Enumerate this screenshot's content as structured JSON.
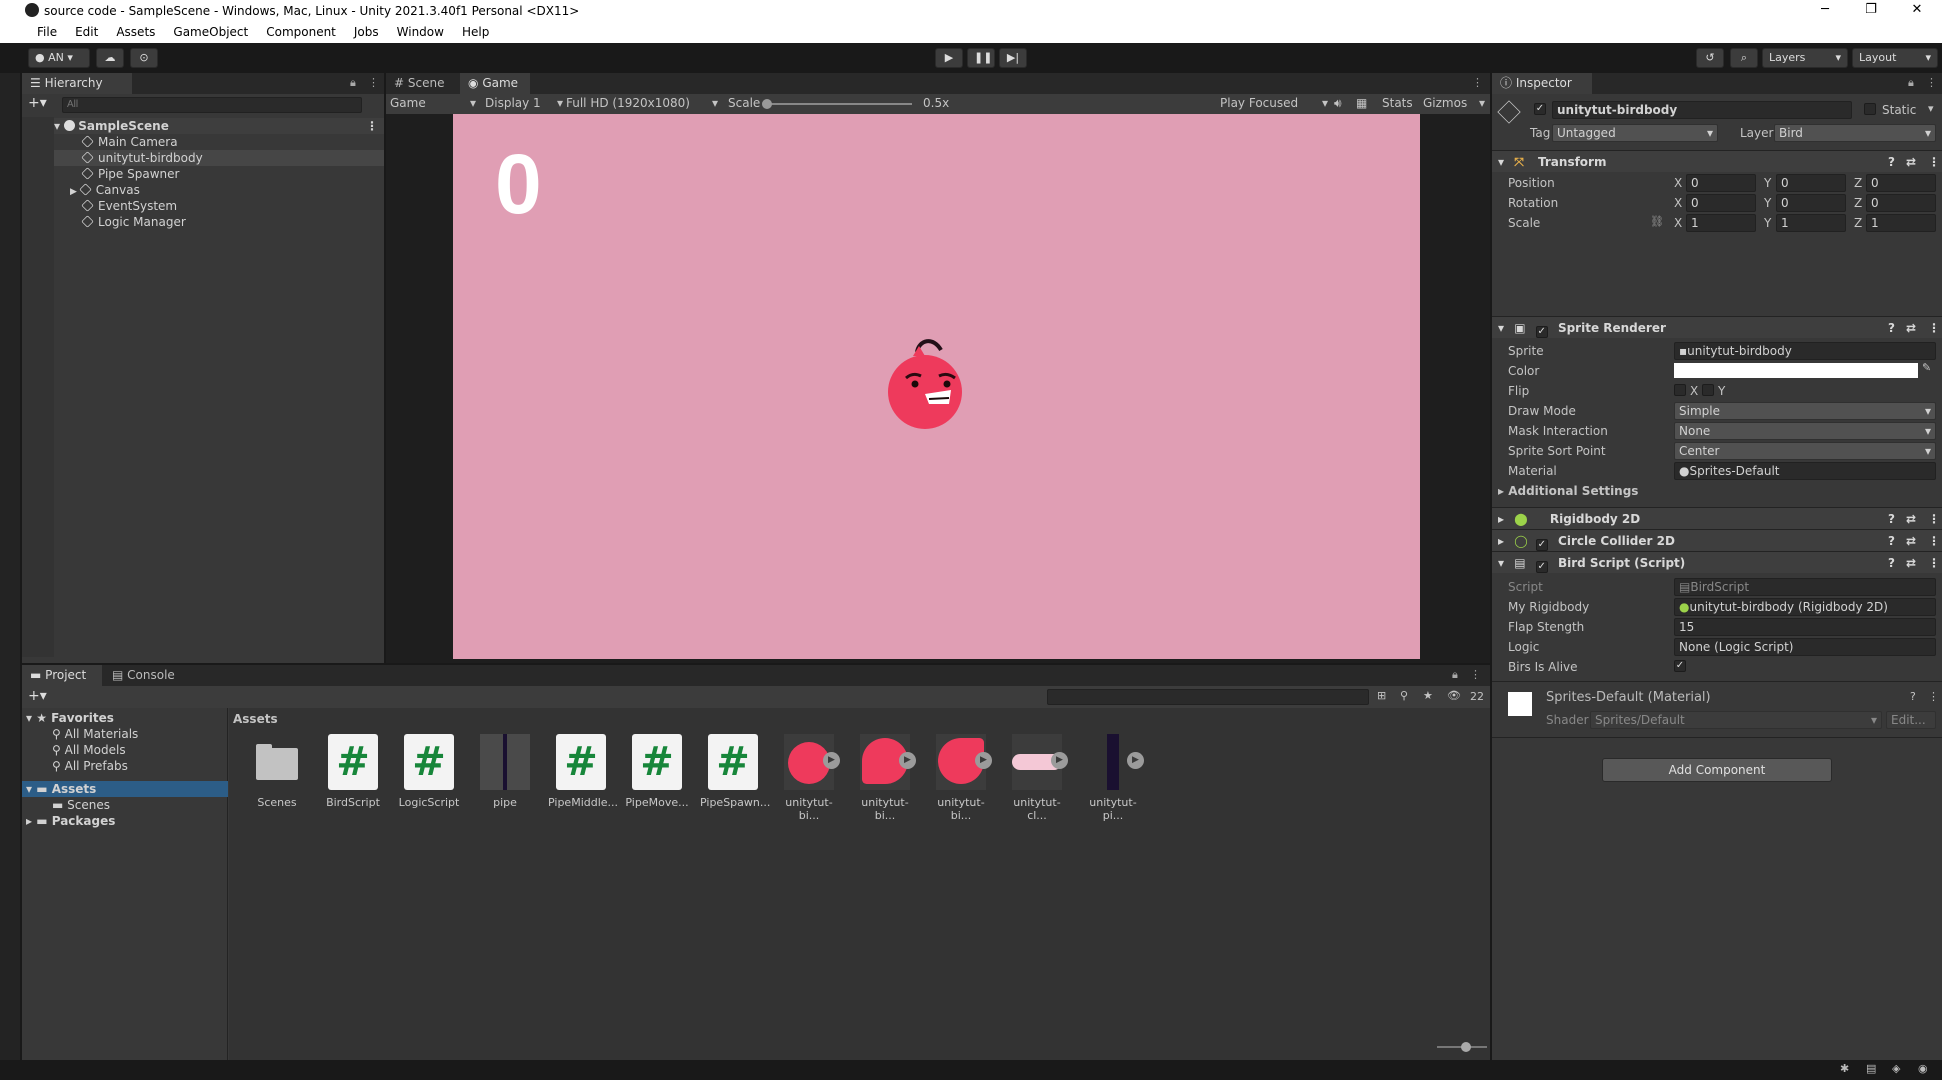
{
  "window": {
    "title": "source code - SampleScene - Windows, Mac, Linux - Unity 2021.3.40f1 Personal <DX11>",
    "min": "─",
    "max": "❐",
    "close": "✕"
  },
  "menu": [
    "File",
    "Edit",
    "Assets",
    "GameObject",
    "Component",
    "Jobs",
    "Window",
    "Help"
  ],
  "toolbar": {
    "account": "AN ▾",
    "layers": "Layers",
    "layout": "Layout"
  },
  "hierarchy": {
    "tab": "Hierarchy",
    "search_placeholder": "All",
    "scene": "SampleScene",
    "items": [
      "Main Camera",
      "unitytut-birdbody",
      "Pipe Spawner",
      "Canvas",
      "EventSystem",
      "Logic Manager"
    ]
  },
  "view": {
    "tabs": [
      "Scene",
      "Game"
    ],
    "game_dd": "Game",
    "display": "Display 1",
    "resolution": "Full HD (1920x1080)",
    "scale_label": "Scale",
    "scale_value": "0.5x",
    "scale_fraction": 0.0,
    "play_focused": "Play Focused",
    "stats": "Stats",
    "gizmos": "Gizmos",
    "score": "0",
    "bg_color": "#e09eb4"
  },
  "inspector": {
    "tab": "Inspector",
    "object_name": "unitytut-birdbody",
    "static": "Static",
    "tag_label": "Tag",
    "tag": "Untagged",
    "layer_label": "Layer",
    "layer": "Bird",
    "transform": {
      "title": "Transform",
      "rows": [
        {
          "label": "Position",
          "x": "0",
          "y": "0",
          "z": "0"
        },
        {
          "label": "Rotation",
          "x": "0",
          "y": "0",
          "z": "0"
        },
        {
          "label": "Scale",
          "x": "1",
          "y": "1",
          "z": "1"
        }
      ]
    },
    "sprite_renderer": {
      "title": "Sprite Renderer",
      "sprite_label": "Sprite",
      "sprite": "unitytut-birdbody",
      "color_label": "Color",
      "flip_label": "Flip",
      "flip_x": "X",
      "flip_y": "Y",
      "draw_mode_label": "Draw Mode",
      "draw_mode": "Simple",
      "mask_label": "Mask Interaction",
      "mask": "None",
      "sort_label": "Sprite Sort Point",
      "sort": "Center",
      "material_label": "Material",
      "material": "Sprites-Default",
      "additional": "Additional Settings"
    },
    "rigidbody": "Rigidbody 2D",
    "collider": "Circle Collider 2D",
    "bird_script": {
      "title": "Bird Script (Script)",
      "script_label": "Script",
      "script": "BirdScript",
      "rb_label": "My Rigidbody",
      "rb": "unitytut-birdbody (Rigidbody 2D)",
      "flap_label": "Flap Stength",
      "flap": "15",
      "logic_label": "Logic",
      "logic": "None (Logic Script)",
      "alive_label": "Birs Is Alive"
    },
    "material": {
      "title": "Sprites-Default (Material)",
      "shader_label": "Shader",
      "shader": "Sprites/Default",
      "edit": "Edit..."
    },
    "add_component": "Add Component"
  },
  "project": {
    "tabs": [
      "Project",
      "Console"
    ],
    "favorites": "Favorites",
    "fav_items": [
      "All Materials",
      "All Models",
      "All Prefabs"
    ],
    "assets": "Assets",
    "scenes": "Scenes",
    "packages": "Packages",
    "breadcrumb": "Assets",
    "count": "22",
    "items": [
      "Scenes",
      "BirdScript",
      "LogicScript",
      "pipe",
      "PipeMiddle...",
      "PipeMove...",
      "PipeSpawn...",
      "unitytut-bi...",
      "unitytut-bi...",
      "unitytut-bi...",
      "unitytut-cl...",
      "unitytut-pi..."
    ]
  }
}
